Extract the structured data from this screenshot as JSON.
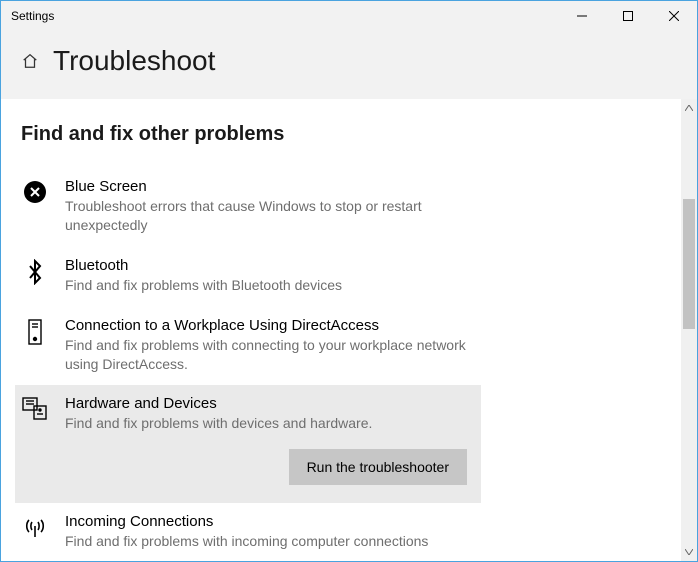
{
  "window": {
    "title": "Settings"
  },
  "header": {
    "title": "Troubleshoot"
  },
  "section": {
    "heading": "Find and fix other problems"
  },
  "items": [
    {
      "title": "Blue Screen",
      "desc": "Troubleshoot errors that cause Windows to stop or restart unexpectedly"
    },
    {
      "title": "Bluetooth",
      "desc": "Find and fix problems with Bluetooth devices"
    },
    {
      "title": "Connection to a Workplace Using DirectAccess",
      "desc": "Find and fix problems with connecting to your workplace network using DirectAccess."
    },
    {
      "title": "Hardware and Devices",
      "desc": "Find and fix problems with devices and hardware."
    },
    {
      "title": "Incoming Connections",
      "desc": "Find and fix problems with incoming computer connections"
    }
  ],
  "buttons": {
    "run": "Run the troubleshooter"
  }
}
